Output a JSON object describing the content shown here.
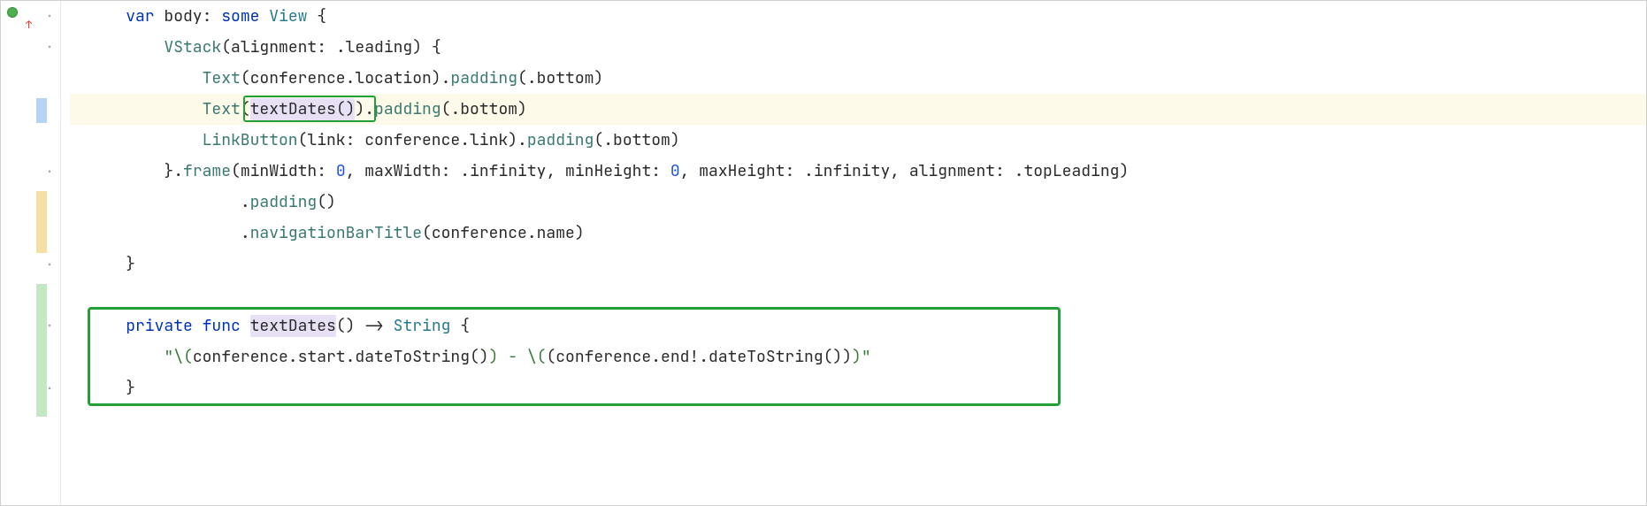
{
  "code": {
    "line1": {
      "indent": "    ",
      "kw_var": "var",
      "name": " body: ",
      "kw_some": "some",
      "type": " View",
      "brace": " {"
    },
    "line2": {
      "indent": "        ",
      "vstack": "VStack",
      "args": "(alignment: .leading) {"
    },
    "line3": {
      "indent": "            ",
      "text": "Text",
      "args": "(conference.location).",
      "padding": "padding",
      "args2": "(.bottom)"
    },
    "line4": {
      "indent": "            ",
      "text": "Text",
      "open": "(",
      "call": "textDates()",
      "close": ").",
      "padding": "padding",
      "args2": "(.bottom)"
    },
    "line5": {
      "indent": "            ",
      "link": "LinkButton",
      "args": "(link: conference.link).",
      "padding": "padding",
      "args2": "(.bottom)"
    },
    "line6": {
      "indent": "        ",
      "close": "}.",
      "frame": "frame",
      "open": "(minWidth: ",
      "zero1": "0",
      "mid1": ", maxWidth: .infinity, minHeight: ",
      "zero2": "0",
      "mid2": ", maxHeight: .infinity, alignment: .topLeading)"
    },
    "line7": {
      "indent": "                ",
      "dot": ".",
      "padding": "padding",
      "args": "()"
    },
    "line8": {
      "indent": "                ",
      "dot": ".",
      "nav": "navigationBarTitle",
      "args": "(conference.name)"
    },
    "line9": {
      "indent": "    ",
      "brace": "}"
    },
    "line10": "",
    "line11": {
      "indent": "    ",
      "kw_private": "private",
      "kw_func": " func ",
      "name": "textDates",
      "sig": "() -> ",
      "ret": "String",
      "brace": " {"
    },
    "line12": {
      "indent": "        ",
      "str1": "\"\\(",
      "expr1": "conference.start.dateToString()",
      "str2": ") - \\(",
      "expr2": "(conference.end!.dateToString())",
      "str3": ")\""
    },
    "line13": {
      "indent": "    ",
      "brace": "}"
    }
  },
  "icons": {
    "run": "run-gutter-icon",
    "fold_open": "▾",
    "fold_close": "▴"
  }
}
